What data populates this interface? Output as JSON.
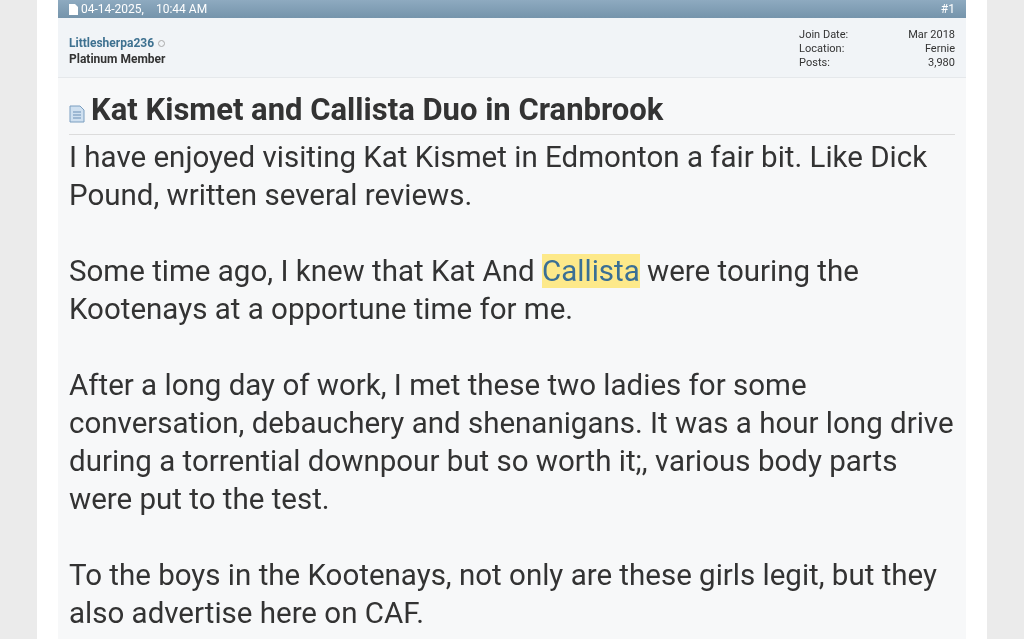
{
  "post_header": {
    "date": "04-14-2025,",
    "time": "10:44 AM",
    "post_number": "#1"
  },
  "user": {
    "name": "Littlesherpa236",
    "online": false,
    "rank": "Platinum Member",
    "stats": [
      {
        "label": "Join Date:",
        "value": "Mar 2018"
      },
      {
        "label": "Location:",
        "value": "Fernie"
      },
      {
        "label": "Posts:",
        "value": "3,980"
      }
    ]
  },
  "post": {
    "title": "Kat Kismet and Callista Duo in Cranbrook",
    "paragraphs": [
      [
        {
          "text": "I have enjoyed visiting Kat Kismet in Edmonton a fair bit. Like Dick Pound, written several reviews.",
          "highlighted": false
        }
      ],
      [
        {
          "text": "Some time ago, I knew that Kat And ",
          "highlighted": false
        },
        {
          "text": "Callista",
          "highlighted": true
        },
        {
          "text": " were touring the Kootenays at a opportune time for me.",
          "highlighted": false
        }
      ],
      [
        {
          "text": "After a long day of work, I met these two ladies for some conversation, debauchery and shenanigans. It was a hour long drive during a torrential downpour but so worth it;, various body parts were put to the test.",
          "highlighted": false
        }
      ],
      [
        {
          "text": "To the boys in the Kootenays, not only are these girls legit, but they also advertise here on CAF.",
          "highlighted": false
        }
      ]
    ]
  }
}
